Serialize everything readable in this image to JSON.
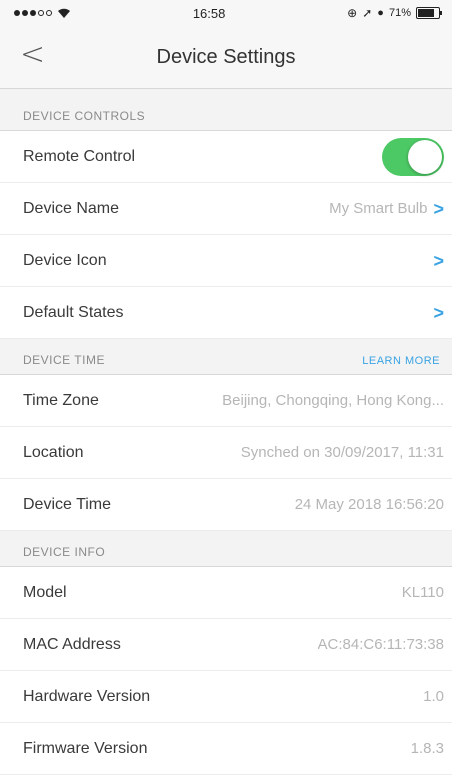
{
  "status_bar": {
    "time": "16:58",
    "battery": "71%",
    "battery_level": 0.71
  },
  "nav": {
    "title": "Device Settings"
  },
  "sections": {
    "controls": {
      "header": "DEVICE CONTROLS",
      "remote_control": {
        "label": "Remote Control",
        "enabled": true
      },
      "device_name": {
        "label": "Device Name",
        "value": "My Smart Bulb"
      },
      "device_icon": {
        "label": "Device Icon"
      },
      "default_states": {
        "label": "Default States"
      }
    },
    "time": {
      "header": "DEVICE TIME",
      "link": "LEARN MORE",
      "time_zone": {
        "label": "Time Zone",
        "value": "Beijing, Chongqing, Hong Kong..."
      },
      "location": {
        "label": "Location",
        "value": "Synched on 30/09/2017, 11:31"
      },
      "device_time": {
        "label": "Device Time",
        "value": "24 May 2018 16:56:20"
      }
    },
    "info": {
      "header": "DEVICE INFO",
      "model": {
        "label": "Model",
        "value": "KL110"
      },
      "mac": {
        "label": "MAC Address",
        "value": "AC:84:C6:11:73:38"
      },
      "hardware": {
        "label": "Hardware Version",
        "value": "1.0"
      },
      "firmware": {
        "label": "Firmware Version",
        "value": "1.8.3"
      }
    }
  }
}
